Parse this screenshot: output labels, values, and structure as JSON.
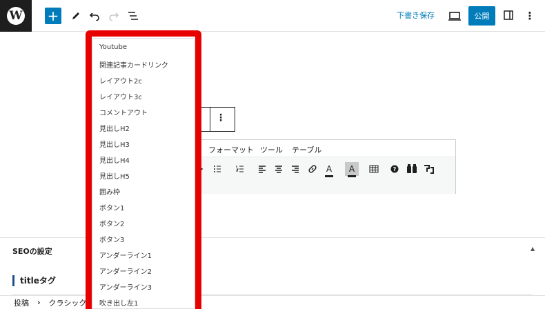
{
  "toolbar": {
    "logo_glyph": "W",
    "add_label": "+",
    "draft_label": "下書き保存",
    "publish_label": "公開",
    "more_label": "⋮"
  },
  "block_toolbar": {
    "more_label": "⋮"
  },
  "classic_editor": {
    "menu": [
      "フォーマット",
      "ツール",
      "テーブル"
    ],
    "text_color_label": "A",
    "bg_color_label": "A"
  },
  "dropdown": {
    "items": [
      "Youtube",
      "関連記事カードリンク",
      "レイアウト2c",
      "レイアウト3c",
      "コメントアウト",
      "見出しH2",
      "見出しH3",
      "見出しH4",
      "見出しH5",
      "囲み枠",
      "ボタン1",
      "ボタン2",
      "ボタン3",
      "アンダーライン1",
      "アンダーライン2",
      "アンダーライン3",
      "吹き出し左1"
    ]
  },
  "seo": {
    "title": "SEOの設定",
    "title_tag_label": "titleタグ"
  },
  "breadcrumb": {
    "items": [
      "投稿",
      "クラシック"
    ],
    "separator": "›"
  },
  "colors": {
    "accent": "#007cba",
    "highlight_frame": "#e60000",
    "dark": "#1e1e1e"
  }
}
